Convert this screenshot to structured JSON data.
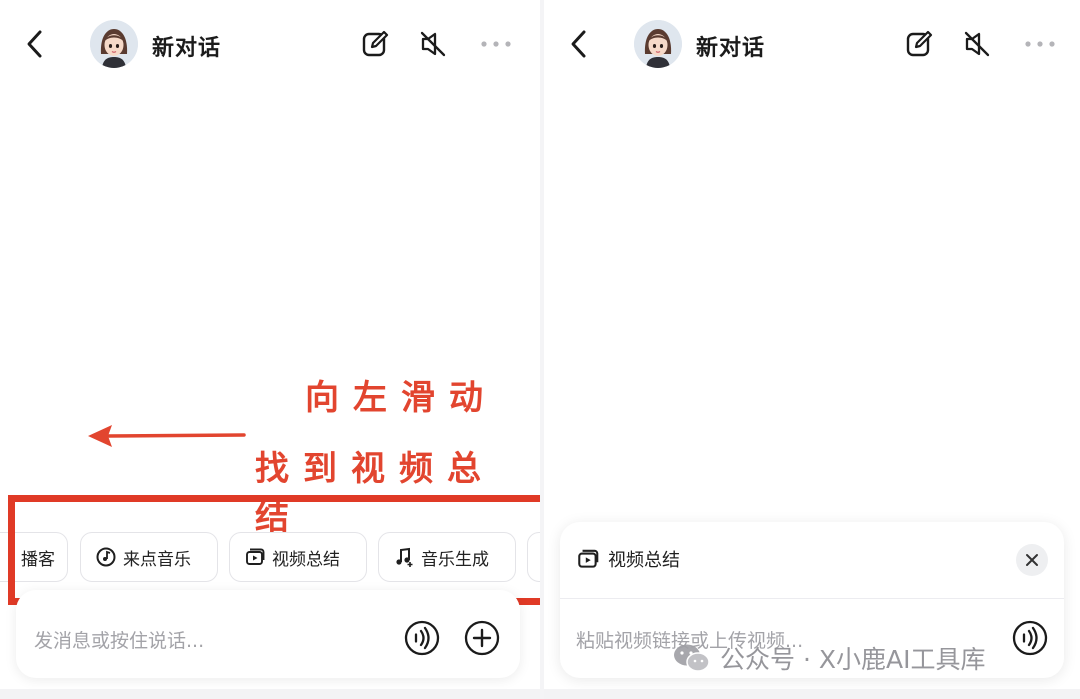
{
  "left": {
    "title": "新对话",
    "chips": [
      {
        "label": "播客",
        "icon": "podcast-icon"
      },
      {
        "label": "来点音乐",
        "icon": "music-disc-icon"
      },
      {
        "label": "视频总结",
        "icon": "video-summary-icon"
      },
      {
        "label": "音乐生成",
        "icon": "music-note-icon"
      }
    ],
    "input_placeholder": "发消息或按住说话...",
    "annotation_line1": "向左滑动",
    "annotation_line2": "找到视频总结"
  },
  "right": {
    "title": "新对话",
    "card_title": "视频总结",
    "input_placeholder": "粘贴视频链接或上传视频..."
  },
  "watermark": "公众号 · X小鹿AI工具库",
  "colors": {
    "annotation_red": "#e2452f",
    "chip_border": "#e4e4e8",
    "placeholder_gray": "#a3a3a8"
  }
}
